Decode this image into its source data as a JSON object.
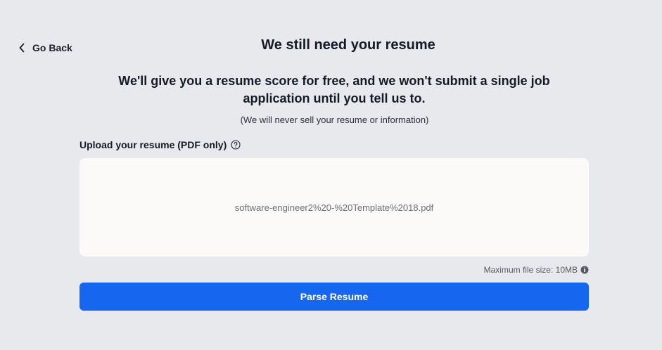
{
  "nav": {
    "back_label": "Go Back"
  },
  "header": {
    "title": "We still need your resume",
    "subtitle": "We'll give you a resume score for free, and we won't submit a single job application until you tell us to.",
    "disclaimer": "(We will never sell your resume or information)"
  },
  "upload": {
    "label": "Upload your resume (PDF only)",
    "file_name": "software-engineer2%20-%20Template%2018.pdf",
    "max_size": "Maximum file size: 10MB"
  },
  "actions": {
    "parse_label": "Parse Resume"
  },
  "colors": {
    "background": "#e8e9ed",
    "dropzone": "#fbfaf9",
    "primary": "#1766f0"
  },
  "icons": {
    "back": "chevron-left-icon",
    "help": "question-circle-icon",
    "info": "info-circle-icon"
  }
}
